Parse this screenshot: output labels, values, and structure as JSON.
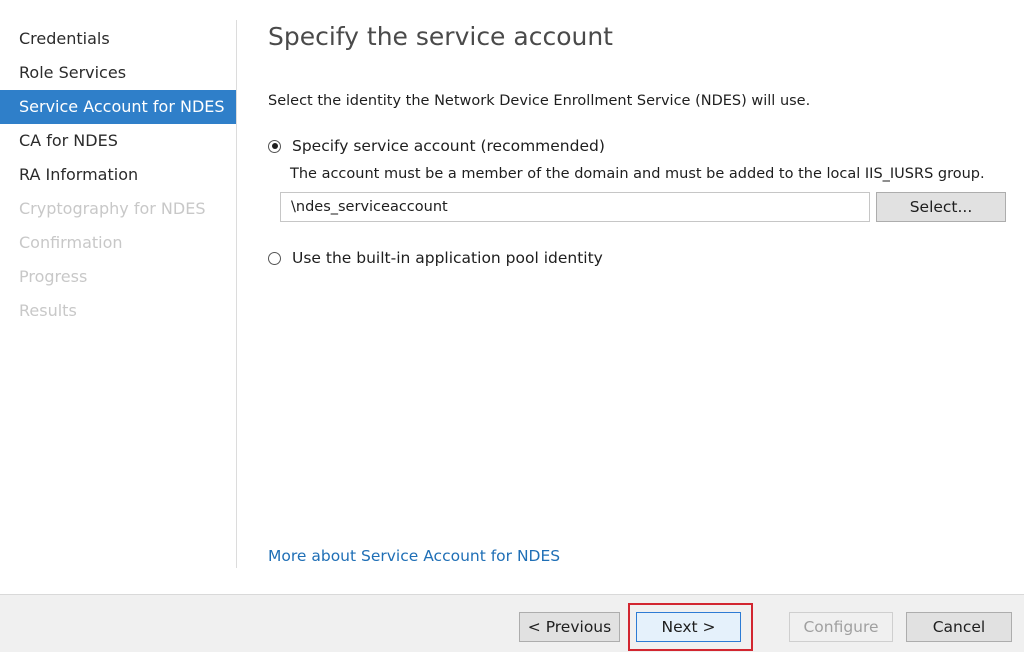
{
  "nav": {
    "items": [
      {
        "label": "Credentials",
        "state": "normal"
      },
      {
        "label": "Role Services",
        "state": "normal"
      },
      {
        "label": "Service Account for NDES",
        "state": "active"
      },
      {
        "label": "CA for NDES",
        "state": "normal"
      },
      {
        "label": "RA Information",
        "state": "normal"
      },
      {
        "label": "Cryptography for NDES",
        "state": "disabled"
      },
      {
        "label": "Confirmation",
        "state": "disabled"
      },
      {
        "label": "Progress",
        "state": "disabled"
      },
      {
        "label": "Results",
        "state": "disabled"
      }
    ]
  },
  "main": {
    "title": "Specify the service account",
    "description": "Select the identity the Network Device Enrollment Service (NDES) will use.",
    "option_specify": {
      "label": "Specify service account (recommended)",
      "checked": true,
      "note": "The account must be a member of the domain and must be added to the local IIS_IUSRS group.",
      "account_value": "\\ndes_serviceaccount",
      "select_label": "Select..."
    },
    "option_builtin": {
      "label": "Use the built-in application pool identity",
      "checked": false
    },
    "help_link": "More about Service Account for NDES"
  },
  "footer": {
    "previous_label": "< Previous",
    "next_label": "Next >",
    "configure_label": "Configure",
    "cancel_label": "Cancel"
  },
  "colors": {
    "active_nav_bg": "#2f7fc9",
    "link": "#1f6fb6",
    "highlight_box": "#d22630"
  }
}
